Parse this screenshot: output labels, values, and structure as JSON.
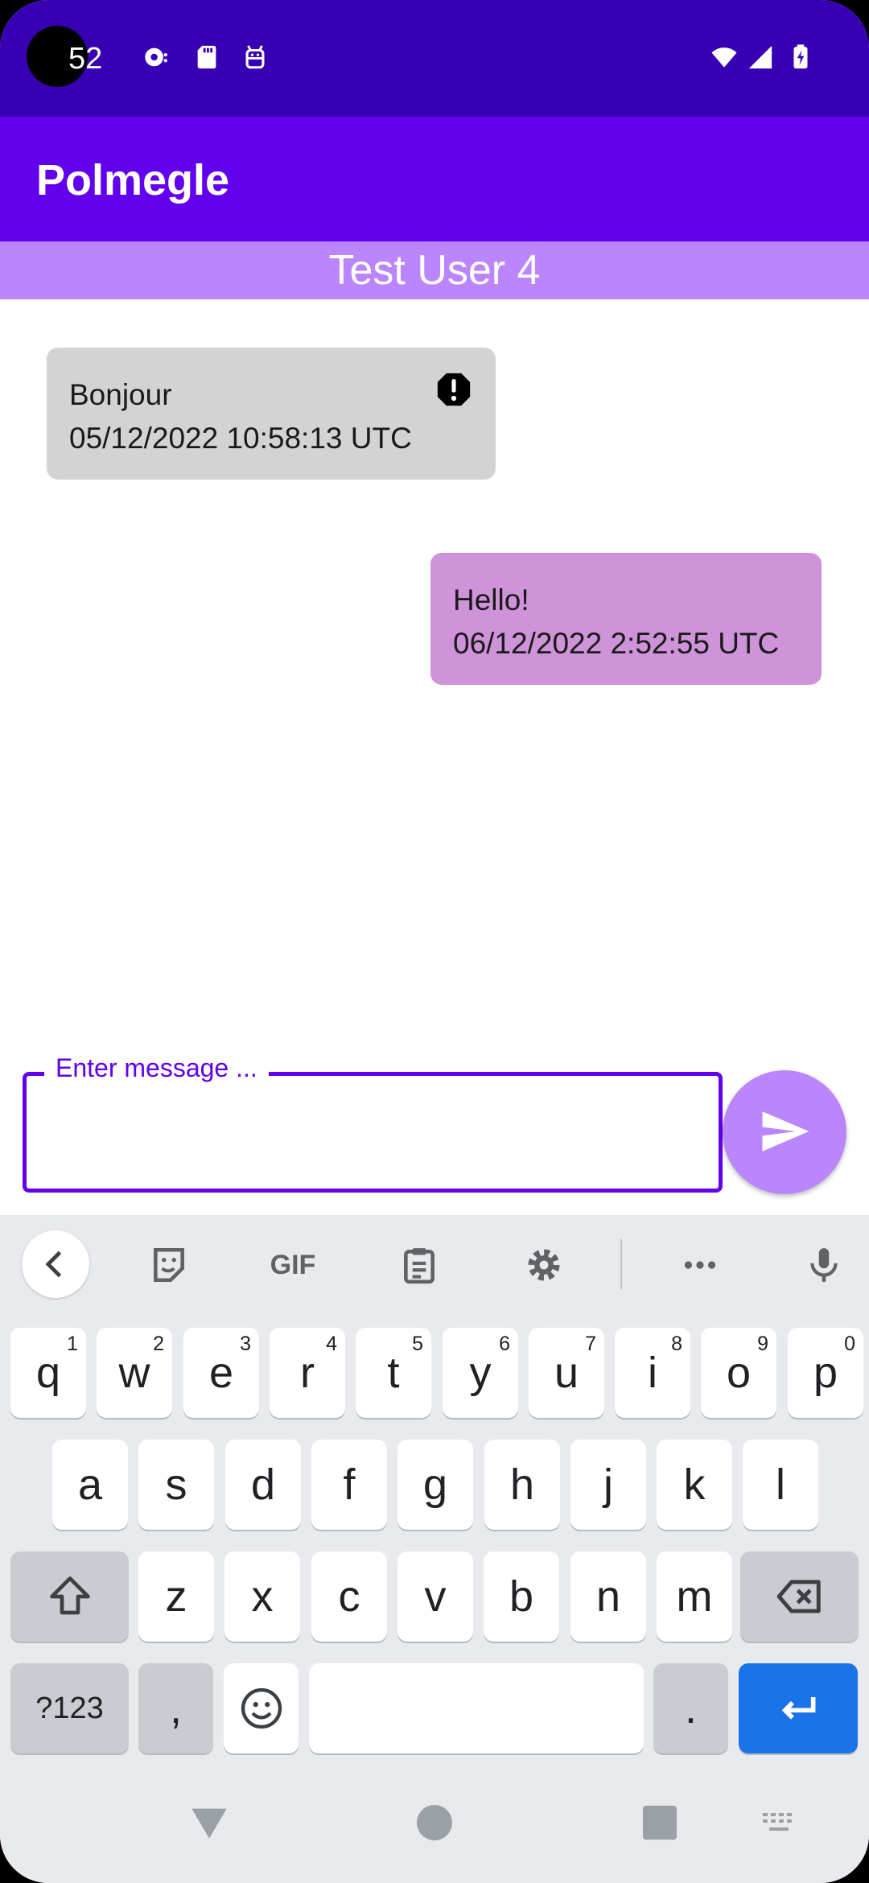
{
  "status_bar": {
    "time": "52",
    "icons": [
      "podcast-icon",
      "sd-card-icon",
      "android-robot-icon",
      "wifi-icon",
      "signal-icon",
      "battery-charging-icon"
    ]
  },
  "app_bar": {
    "title": "Polmegle"
  },
  "contact": {
    "name": "Test User 4"
  },
  "messages": [
    {
      "text": "Bonjour",
      "timestamp": "05/12/2022 10:58:13 UTC",
      "direction": "received",
      "status_icon": "error-icon"
    },
    {
      "text": "Hello!",
      "timestamp": "06/12/2022 2:52:55 UTC",
      "direction": "sent"
    }
  ],
  "composer": {
    "label": "Enter message ...",
    "value": "",
    "send_icon": "send-icon"
  },
  "keyboard": {
    "toolbar": {
      "gif_label": "GIF"
    },
    "row1": [
      {
        "k": "q",
        "h": "1"
      },
      {
        "k": "w",
        "h": "2"
      },
      {
        "k": "e",
        "h": "3"
      },
      {
        "k": "r",
        "h": "4"
      },
      {
        "k": "t",
        "h": "5"
      },
      {
        "k": "y",
        "h": "6"
      },
      {
        "k": "u",
        "h": "7"
      },
      {
        "k": "i",
        "h": "8"
      },
      {
        "k": "o",
        "h": "9"
      },
      {
        "k": "p",
        "h": "0"
      }
    ],
    "row2": [
      "a",
      "s",
      "d",
      "f",
      "g",
      "h",
      "j",
      "k",
      "l"
    ],
    "row3": [
      "z",
      "x",
      "c",
      "v",
      "b",
      "n",
      "m"
    ],
    "symbols_label": "?123",
    "comma_label": ",",
    "period_label": "."
  },
  "colors": {
    "status_bar": "#3700b3",
    "app_bar": "#6200ee",
    "contact_bar": "#bb86fc",
    "received_bubble": "#d3d3d3",
    "sent_bubble": "#ce93d8",
    "enter_key": "#1a73e8"
  }
}
